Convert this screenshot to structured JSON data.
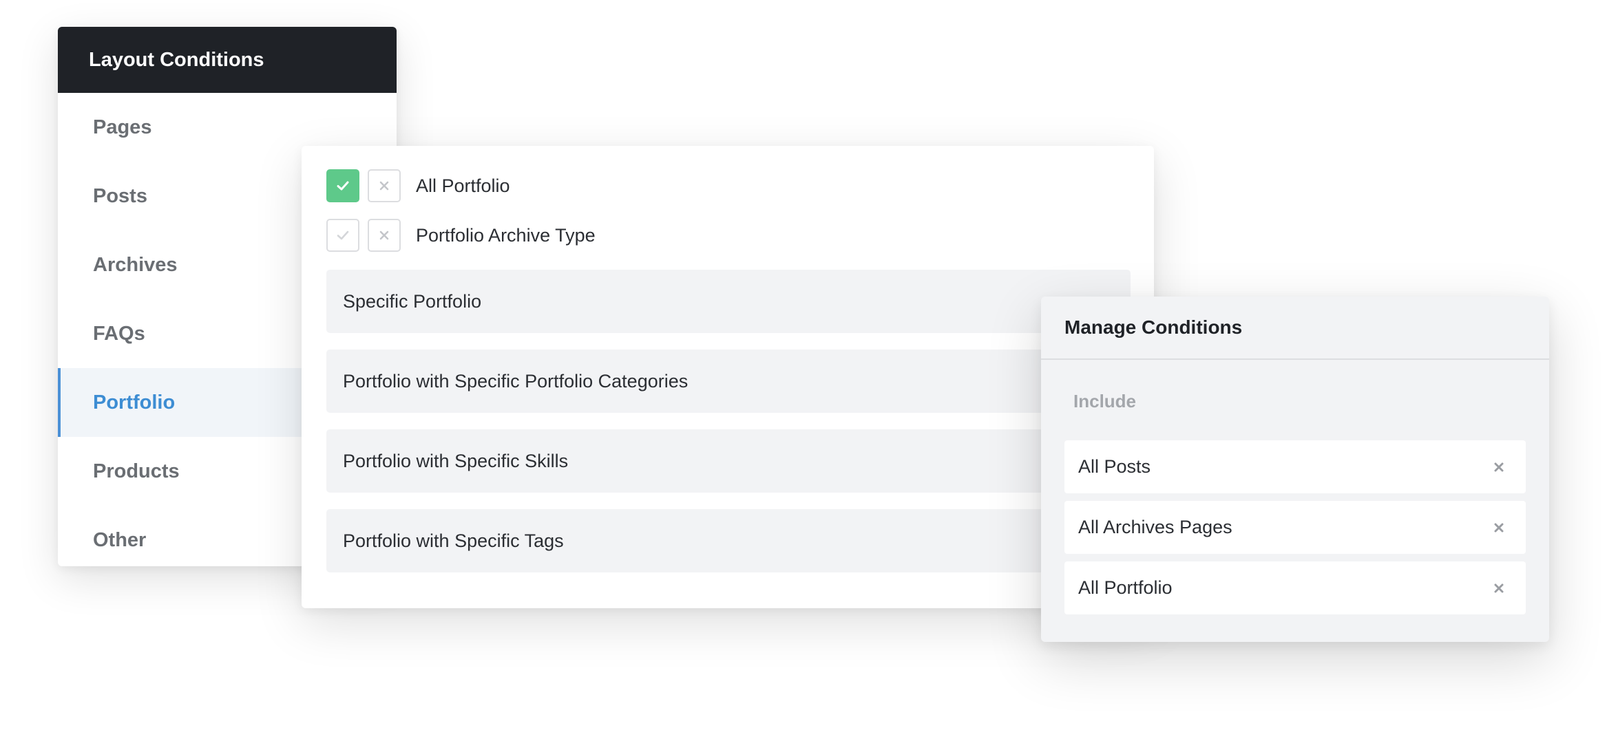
{
  "layout_conditions": {
    "title": "Layout Conditions",
    "items": [
      {
        "label": "Pages",
        "active": false
      },
      {
        "label": "Posts",
        "active": false
      },
      {
        "label": "Archives",
        "active": false
      },
      {
        "label": "FAQs",
        "active": false
      },
      {
        "label": "Portfolio",
        "active": true
      },
      {
        "label": "Products",
        "active": false
      },
      {
        "label": "Other",
        "active": false
      }
    ]
  },
  "options": {
    "checks": [
      {
        "label": "All Portfolio",
        "included": true,
        "excluded": false
      },
      {
        "label": "Portfolio Archive Type",
        "included": false,
        "excluded": false
      }
    ],
    "items": [
      {
        "label": "Specific Portfolio"
      },
      {
        "label": "Portfolio with Specific Portfolio Categories"
      },
      {
        "label": "Portfolio with Specific Skills"
      },
      {
        "label": "Portfolio with Specific Tags"
      }
    ]
  },
  "manage_conditions": {
    "title": "Manage Conditions",
    "section_label": "Include",
    "items": [
      {
        "label": "All Posts"
      },
      {
        "label": "All Archives Pages"
      },
      {
        "label": "All Portfolio"
      }
    ]
  },
  "colors": {
    "header_dark": "#1f2227",
    "accent_blue": "#3d8dd3",
    "check_green": "#5ec98a"
  }
}
